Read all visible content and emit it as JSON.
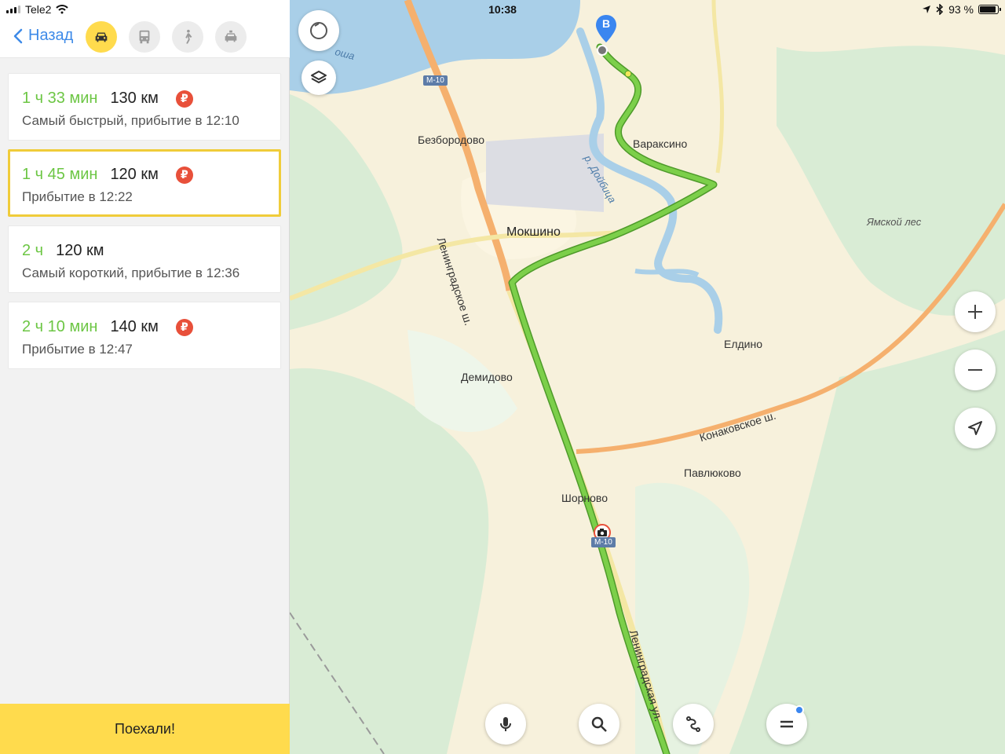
{
  "status_bar": {
    "carrier": "Tele2",
    "time": "10:38",
    "battery": "93 %",
    "battery_level": 0.93
  },
  "header": {
    "back_label": "Назад",
    "modes": [
      {
        "name": "car-icon",
        "active": true
      },
      {
        "name": "bus-icon",
        "active": false
      },
      {
        "name": "walk-icon",
        "active": false
      },
      {
        "name": "taxi-icon",
        "active": false
      }
    ]
  },
  "routes": [
    {
      "time": "1 ч 33 мин",
      "distance": "130 км",
      "toll": true,
      "toll_symbol": "₽",
      "description": "Самый быстрый, прибытие в 12:10",
      "selected": false
    },
    {
      "time": "1 ч 45 мин",
      "distance": "120 км",
      "toll": true,
      "toll_symbol": "₽",
      "description": "Прибытие в 12:22",
      "selected": true
    },
    {
      "time": "2 ч",
      "distance": "120 км",
      "toll": false,
      "description": "Самый короткий, прибытие в 12:36",
      "selected": false
    },
    {
      "time": "2 ч 10 мин",
      "distance": "140 км",
      "toll": true,
      "toll_symbol": "₽",
      "description": "Прибытие в 12:47",
      "selected": false
    }
  ],
  "go_button": "Поехали!",
  "map": {
    "destination_marker": "B",
    "place_labels": {
      "bezborodovo": "Безбородово",
      "varaksino": "Вараксино",
      "mokshino": "Мокшино",
      "yamskoy_les": "Ямской лес",
      "eldino": "Елдино",
      "demidovo": "Демидово",
      "pavlyukovo": "Павлюково",
      "shornovo": "Шорново"
    },
    "road_labels": {
      "leningradskoe": "Ленинградское ш.",
      "konakovskoe": "Конаковское ш.",
      "leningradskaya_ul": "Ленинградская ул.",
      "m10_top": "М-10",
      "m10_bottom": "М-10"
    },
    "river_labels": {
      "doybitsa": "р. Дойбица",
      "sha": "оша"
    },
    "colors": {
      "route": "#7ccf4a",
      "route_outline": "#4e9a2a",
      "water": "#a9cfe8",
      "forest": "#d9ecd5",
      "highway": "#f5b06e",
      "selected_border": "#f0cc3a",
      "accent_yellow": "#ffdb4d",
      "link_blue": "#3d8ae8",
      "toll_red": "#e8503a"
    },
    "controls": [
      "compass-icon",
      "layers-icon",
      "zoom-in-icon",
      "zoom-out-icon",
      "location-arrow-icon",
      "microphone-icon",
      "search-icon",
      "route-icon",
      "menu-icon"
    ]
  }
}
